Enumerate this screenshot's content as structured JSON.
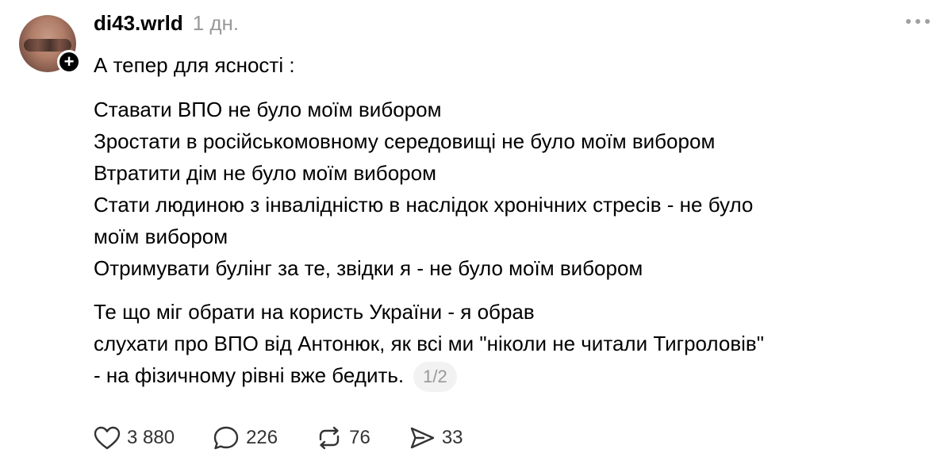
{
  "post": {
    "username": "di43.wrld",
    "time": "1 дн.",
    "lines": {
      "l1": "А тепер для ясності :",
      "l2": "Ставати ВПО не було моїм вибором",
      "l3": "Зростати в російськомовному середовищі не було моїм вибором",
      "l4": "Втратити дім не було моїм вибором",
      "l5": "Стати людиною з інвалідністю в наслідок хронічних стресів - не було",
      "l6": "моїм вибором",
      "l7": "Отримувати булінг за те, звідки я - не було моїм вибором",
      "l8": "Те що міг обрати на користь України - я обрав",
      "l9": "слухати про ВПО від Антонюк, як всі ми \"ніколи не читали Тигроловів\"",
      "l10": "- на фізичному рівні вже бедить."
    },
    "pager": "1/2"
  },
  "actions": {
    "likes": "3 880",
    "comments": "226",
    "reposts": "76",
    "shares": "33"
  },
  "icons": {
    "like": "heart-icon",
    "comment": "comment-bubble-icon",
    "repost": "repost-icon",
    "share": "send-icon",
    "more": "more-horizontal-icon",
    "follow": "plus-icon"
  }
}
